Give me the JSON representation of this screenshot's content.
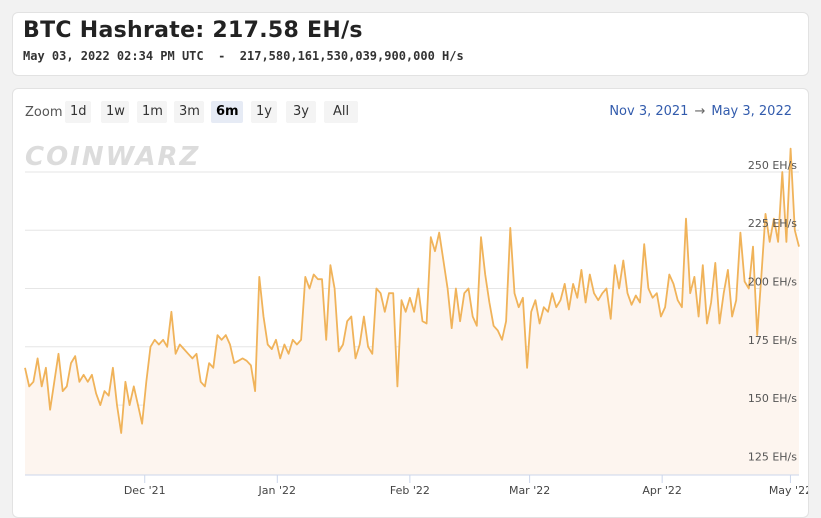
{
  "header": {
    "title": "BTC Hashrate: 217.58 EH/s",
    "timestamp": "May 03, 2022 02:34 PM UTC",
    "separator": "-",
    "raw_value": "217,580,161,530,039,900,000 H/s"
  },
  "toolbar": {
    "zoom_label": "Zoom",
    "buttons": [
      "1d",
      "1w",
      "1m",
      "3m",
      "6m",
      "1y",
      "3y",
      "All"
    ],
    "active": "6m",
    "range_from": "Nov 3, 2021",
    "range_arrow": "→",
    "range_to": "May 3, 2022"
  },
  "watermark": "COINWARZ",
  "colors": {
    "line": "#f0b35a",
    "fill": "#fdf5ef",
    "range_text": "#335cad"
  },
  "chart_data": {
    "type": "area",
    "title": "",
    "xlabel": "",
    "ylabel": "",
    "ylim": [
      120,
      265
    ],
    "y_ticks": [
      {
        "value": 125,
        "label": "125 EH/s"
      },
      {
        "value": 150,
        "label": "150 EH/s"
      },
      {
        "value": 175,
        "label": "175 EH/s"
      },
      {
        "value": 200,
        "label": "200 EH/s"
      },
      {
        "value": 225,
        "label": "225 EH/s"
      },
      {
        "value": 250,
        "label": "250 EH/s"
      }
    ],
    "x_ticks": [
      {
        "date": "2021-12-01",
        "label": "Dec '21"
      },
      {
        "date": "2022-01-01",
        "label": "Jan '22"
      },
      {
        "date": "2022-02-01",
        "label": "Feb '22"
      },
      {
        "date": "2022-03-01",
        "label": "Mar '22"
      },
      {
        "date": "2022-04-01",
        "label": "Apr '22"
      },
      {
        "date": "2022-05-01",
        "label": "May '22"
      }
    ],
    "grid": true,
    "x_start": "2021-11-03",
    "x_end": "2022-05-03",
    "series": [
      {
        "values": [
          166,
          158,
          160,
          170,
          158,
          166,
          148,
          160,
          172,
          156,
          158,
          168,
          171,
          160,
          163,
          160,
          163,
          155,
          150,
          156,
          154,
          166,
          150,
          138,
          160,
          150,
          158,
          150,
          142,
          160,
          175,
          178,
          176,
          178,
          175,
          190,
          172,
          176,
          174,
          172,
          170,
          172,
          160,
          158,
          168,
          166,
          180,
          178,
          180,
          176,
          168,
          169,
          170,
          169,
          167,
          156,
          205,
          188,
          176,
          174,
          178,
          170,
          176,
          172,
          178,
          176,
          178,
          205,
          200,
          206,
          204,
          204,
          178,
          210,
          200,
          173,
          176,
          186,
          188,
          170,
          176,
          188,
          175,
          172,
          200,
          198,
          190,
          198,
          198,
          158,
          195,
          190,
          196,
          190,
          200,
          186,
          185,
          222,
          216,
          224,
          212,
          200,
          183,
          200,
          186,
          198,
          200,
          188,
          184,
          222,
          206,
          194,
          184,
          182,
          178,
          186,
          226,
          198,
          192,
          196,
          166,
          190,
          195,
          185,
          192,
          190,
          198,
          192,
          195,
          202,
          191,
          202,
          196,
          208,
          194,
          206,
          198,
          195,
          198,
          200,
          187,
          210,
          200,
          212,
          198,
          193,
          197,
          194,
          219,
          200,
          196,
          198,
          188,
          192,
          206,
          202,
          195,
          192,
          230,
          198,
          205,
          188,
          210,
          185,
          194,
          211,
          185,
          198,
          208,
          188,
          195,
          224,
          203,
          200,
          218,
          180,
          205,
          232,
          220,
          230,
          220,
          250,
          220,
          260,
          225,
          218
        ]
      }
    ]
  }
}
